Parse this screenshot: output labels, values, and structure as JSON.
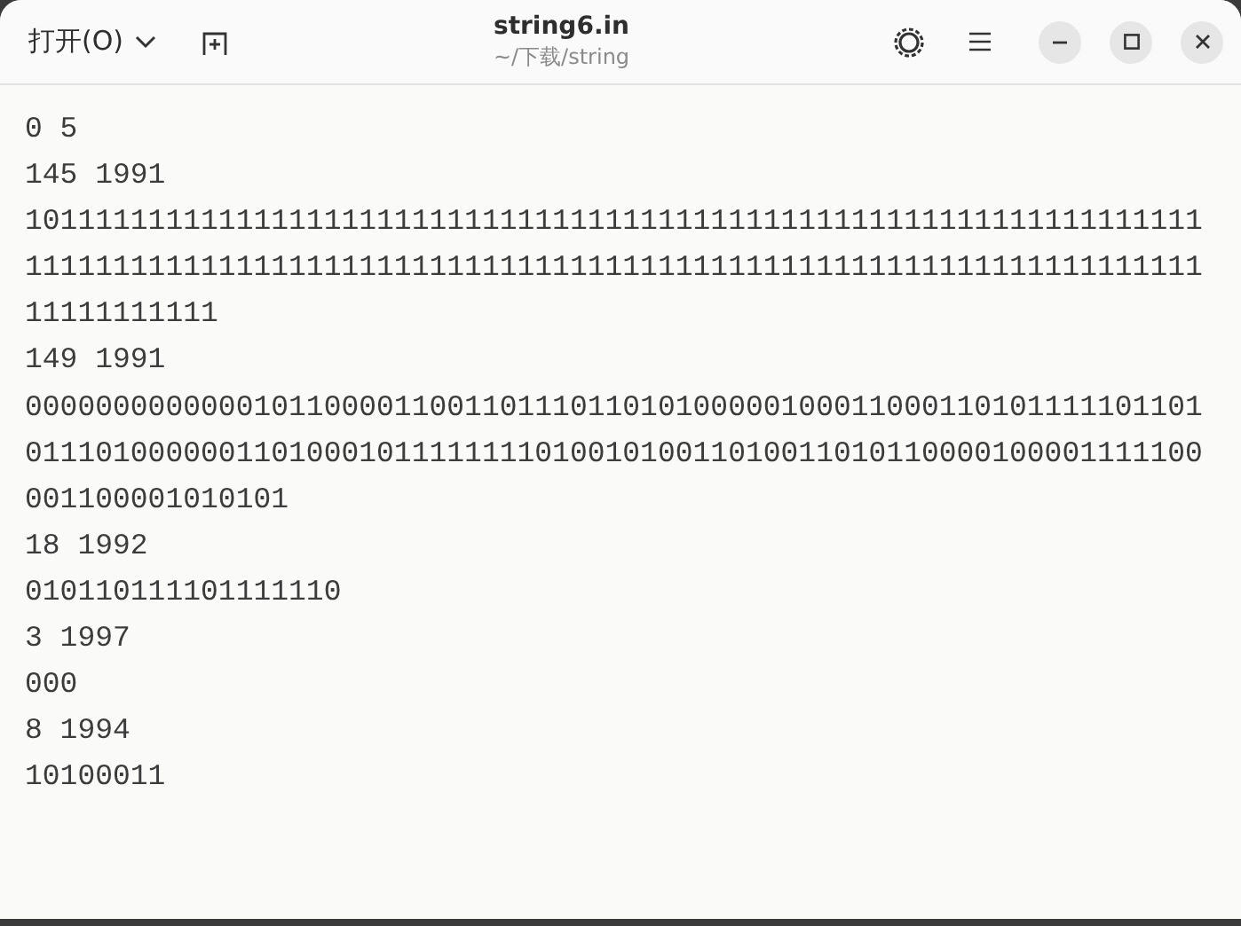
{
  "header": {
    "open_button": "打开(O)",
    "title": "string6.in",
    "path": "~/下载/string"
  },
  "lines": [
    "0 5",
    "145 1991",
    "1011111111111111111111111111111111111111111111111111111111111111111111111111111111111111111111111111111111111111111111111111111111111111111111111",
    "149 1991",
    "00000000000001011000011001101110110101000001000110001101011111011010111010000001101000101111111101001010011010011010110000100001111100001100001010101",
    "18 1992",
    "010110111101111110",
    "3 1997",
    "000",
    "8 1994",
    "10100011"
  ]
}
